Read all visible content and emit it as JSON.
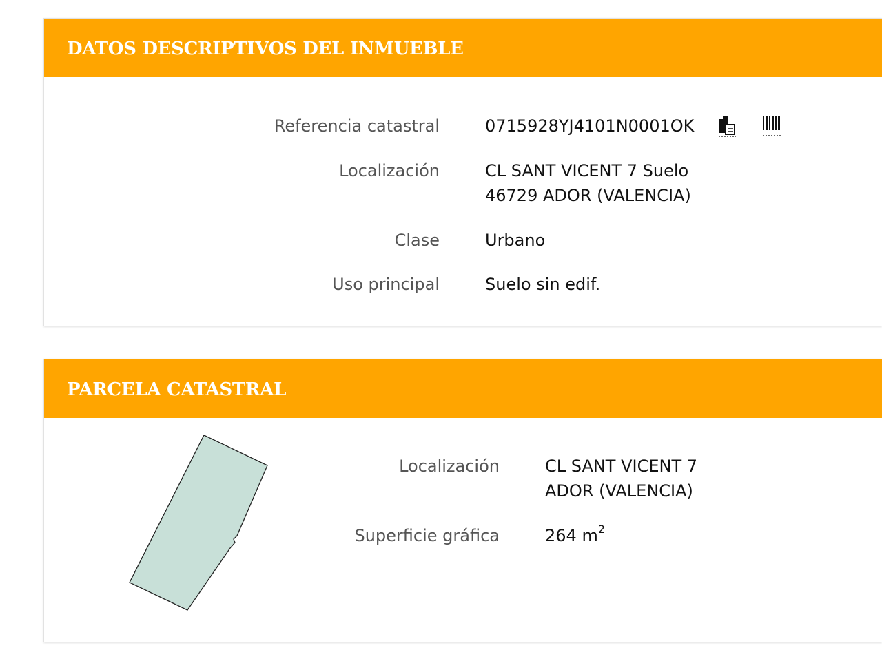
{
  "inmueble": {
    "title": "DATOS DESCRIPTIVOS DEL INMUEBLE",
    "referencia_label": "Referencia catastral",
    "referencia_value": "0715928YJ4101N0001OK",
    "copy_icon": "copy-icon",
    "barcode_icon": "barcode-icon",
    "localizacion_label": "Localización",
    "localizacion_value": "CL SANT VICENT 7 Suelo\n46729 ADOR (VALENCIA)",
    "clase_label": "Clase",
    "clase_value": "Urbano",
    "uso_label": "Uso principal",
    "uso_value": "Suelo sin edif."
  },
  "parcela": {
    "title": "PARCELA CATASTRAL",
    "localizacion_label": "Localización",
    "localizacion_value": "CL SANT VICENT 7\nADOR (VALENCIA)",
    "superficie_label": "Superficie gráfica",
    "superficie_value": "264 m",
    "superficie_unit_sup": "2",
    "parcel_fill": "#c8e0d8"
  },
  "colors": {
    "header_bg": "#ffa500",
    "header_text": "#ffffff"
  }
}
